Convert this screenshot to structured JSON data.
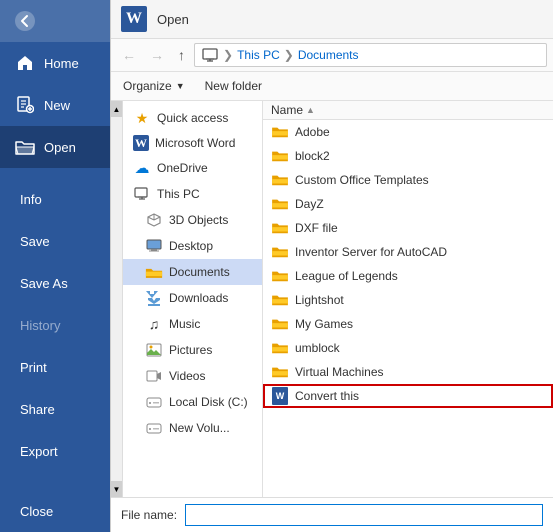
{
  "dialog": {
    "title": "Open",
    "breadcrumb": {
      "parts": [
        "This PC",
        "Documents"
      ]
    }
  },
  "toolbar": {
    "organize_label": "Organize",
    "new_folder_label": "New folder"
  },
  "nav_panel": {
    "items": [
      {
        "id": "quick-access",
        "label": "Quick access",
        "icon": "star"
      },
      {
        "id": "microsoft-word",
        "label": "Microsoft Word",
        "icon": "word"
      },
      {
        "id": "onedrive",
        "label": "OneDrive",
        "icon": "cloud"
      },
      {
        "id": "this-pc",
        "label": "This PC",
        "icon": "pc"
      },
      {
        "id": "3d-objects",
        "label": "3D Objects",
        "icon": "cube"
      },
      {
        "id": "desktop",
        "label": "Desktop",
        "icon": "desktop"
      },
      {
        "id": "documents",
        "label": "Documents",
        "icon": "folder",
        "selected": true
      },
      {
        "id": "downloads",
        "label": "Downloads",
        "icon": "down-arrow"
      },
      {
        "id": "music",
        "label": "Music",
        "icon": "music"
      },
      {
        "id": "pictures",
        "label": "Pictures",
        "icon": "picture"
      },
      {
        "id": "videos",
        "label": "Videos",
        "icon": "video"
      },
      {
        "id": "local-disk-c",
        "label": "Local Disk (C:)",
        "icon": "disk"
      },
      {
        "id": "new-volume",
        "label": "New Volu...",
        "icon": "disk"
      }
    ]
  },
  "file_list": {
    "column_name": "Name",
    "items": [
      {
        "name": "Adobe",
        "type": "folder"
      },
      {
        "name": "block2",
        "type": "folder"
      },
      {
        "name": "Custom Office Templates",
        "type": "folder"
      },
      {
        "name": "DayZ",
        "type": "folder"
      },
      {
        "name": "DXF file",
        "type": "folder"
      },
      {
        "name": "Inventor Server for AutoCAD",
        "type": "folder"
      },
      {
        "name": "League of Legends",
        "type": "folder"
      },
      {
        "name": "Lightshot",
        "type": "folder"
      },
      {
        "name": "My Games",
        "type": "folder"
      },
      {
        "name": "umblock",
        "type": "folder"
      },
      {
        "name": "Virtual Machines",
        "type": "folder"
      },
      {
        "name": "Convert this",
        "type": "word-file",
        "highlighted": true
      }
    ]
  },
  "sidebar": {
    "items": [
      {
        "id": "home",
        "label": "Home",
        "icon": "home"
      },
      {
        "id": "new",
        "label": "New",
        "icon": "new-doc",
        "active": false
      },
      {
        "id": "open",
        "label": "Open",
        "icon": "open-folder",
        "active": true
      },
      {
        "id": "info",
        "label": "Info",
        "icon": null
      },
      {
        "id": "save",
        "label": "Save",
        "icon": null
      },
      {
        "id": "save-as",
        "label": "Save As",
        "icon": null
      },
      {
        "id": "history",
        "label": "History",
        "icon": null,
        "dimmed": true
      },
      {
        "id": "print",
        "label": "Print",
        "icon": null
      },
      {
        "id": "share",
        "label": "Share",
        "icon": null
      },
      {
        "id": "export",
        "label": "Export",
        "icon": null
      },
      {
        "id": "close",
        "label": "Close",
        "icon": null
      }
    ]
  },
  "filename_bar": {
    "label": "File name:",
    "value": ""
  }
}
